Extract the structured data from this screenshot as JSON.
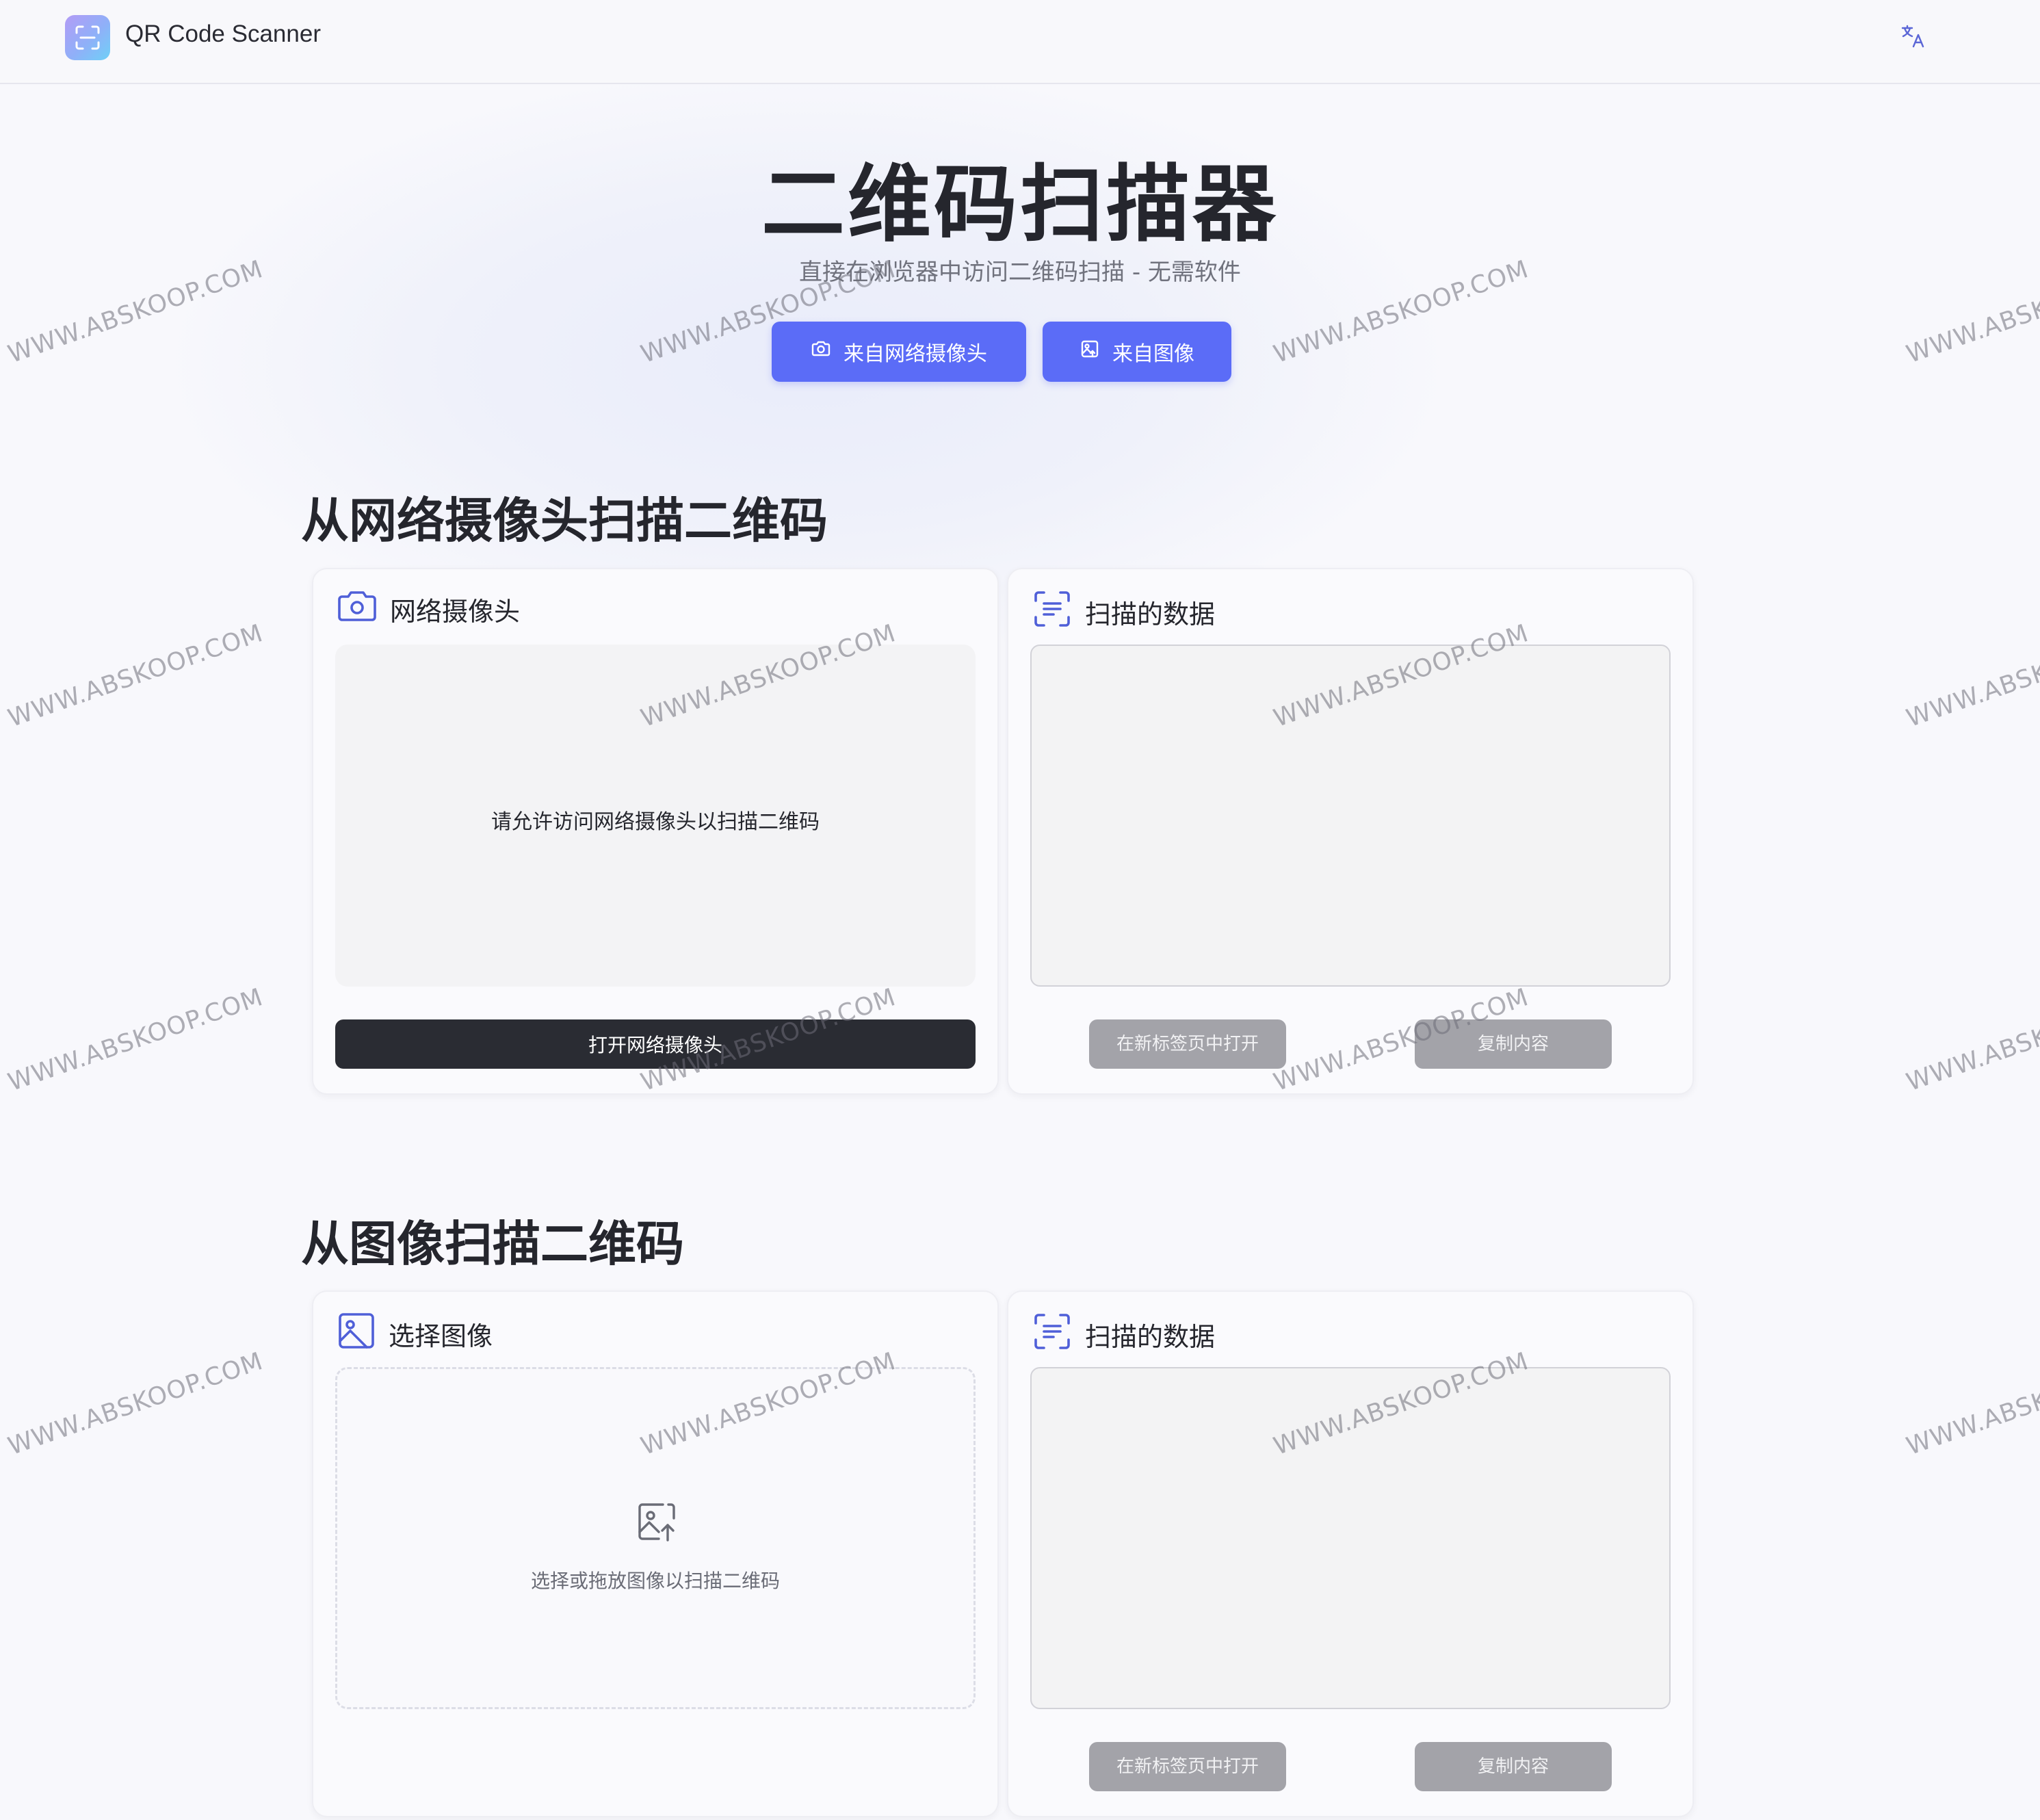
{
  "header": {
    "app_title": "QR Code Scanner",
    "logo_icon": "qr-scan-icon",
    "language_icon": "translate-icon"
  },
  "hero": {
    "title": "二维码扫描器",
    "subtitle": "直接在浏览器中访问二维码扫描 - 无需软件",
    "buttons": [
      {
        "label": "来自网络摄像头",
        "icon": "camera-icon"
      },
      {
        "label": "来自图像",
        "icon": "image-icon"
      }
    ]
  },
  "webcam_section": {
    "title": "从网络摄像头扫描二维码",
    "camera_card": {
      "heading": "网络摄像头",
      "message": "请允许访问网络摄像头以扫描二维码",
      "open_button": "打开网络摄像头"
    },
    "data_card": {
      "heading": "扫描的数据",
      "textarea_value": "",
      "open_tab_button": "在新标签页中打开",
      "copy_button": "复制内容"
    }
  },
  "image_section": {
    "title": "从图像扫描二维码",
    "image_card": {
      "heading": "选择图像",
      "drop_message": "选择或拖放图像以扫描二维码"
    },
    "data_card": {
      "heading": "扫描的数据",
      "textarea_value": "",
      "open_tab_button": "在新标签页中打开",
      "copy_button": "复制内容"
    }
  },
  "watermark": "WWW.ABSKOOP.COM",
  "colors": {
    "accent": "#5b6cf7",
    "dark_button": "#2a2c33",
    "disabled_button": "#a3a3a9",
    "icon_blue": "#4f5fd8"
  }
}
